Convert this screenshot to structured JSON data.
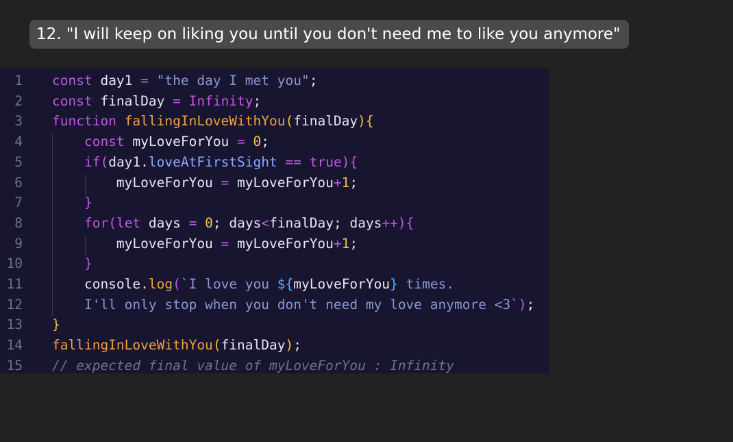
{
  "caption": "12.  \"I will keep on liking you until you don't need me to like you anymore\"",
  "code": {
    "lines": [
      {
        "num": "1",
        "tokens": [
          [
            "c-key",
            "const "
          ],
          [
            "c-var",
            "day1 "
          ],
          [
            "c-op",
            "= "
          ],
          [
            "c-str",
            "\"the day I met you\""
          ],
          [
            "c-punct",
            ";"
          ]
        ]
      },
      {
        "num": "2",
        "tokens": [
          [
            "c-key",
            "const "
          ],
          [
            "c-var",
            "finalDay "
          ],
          [
            "c-op",
            "= "
          ],
          [
            "c-key",
            "Infinity"
          ],
          [
            "c-punct",
            ";"
          ]
        ]
      },
      {
        "num": "3",
        "tokens": [
          [
            "c-key",
            "function "
          ],
          [
            "c-fn",
            "fallingInLoveWithYou"
          ],
          [
            "c-paren",
            "("
          ],
          [
            "c-var",
            "finalDay"
          ],
          [
            "c-paren",
            ")"
          ],
          [
            "c-paren",
            "{"
          ]
        ]
      },
      {
        "num": "4",
        "tokens": [
          [
            "c-var",
            "    "
          ],
          [
            "c-key",
            "const "
          ],
          [
            "c-var",
            "myLoveForYou "
          ],
          [
            "c-op",
            "= "
          ],
          [
            "c-num",
            "0"
          ],
          [
            "c-punct",
            ";"
          ]
        ]
      },
      {
        "num": "5",
        "tokens": [
          [
            "c-var",
            "    "
          ],
          [
            "c-key",
            "if"
          ],
          [
            "c-paren2",
            "("
          ],
          [
            "c-var",
            "day1."
          ],
          [
            "c-prop",
            "loveAtFirstSight "
          ],
          [
            "c-op",
            "== "
          ],
          [
            "c-key",
            "true"
          ],
          [
            "c-paren2",
            ")"
          ],
          [
            "c-paren2",
            "{"
          ]
        ]
      },
      {
        "num": "6",
        "tokens": [
          [
            "c-var",
            "        myLoveForYou "
          ],
          [
            "c-op",
            "= "
          ],
          [
            "c-var",
            "myLoveForYou"
          ],
          [
            "c-op",
            "+"
          ],
          [
            "c-num",
            "1"
          ],
          [
            "c-punct",
            ";"
          ]
        ]
      },
      {
        "num": "7",
        "tokens": [
          [
            "c-var",
            "    "
          ],
          [
            "c-paren2",
            "}"
          ]
        ]
      },
      {
        "num": "8",
        "tokens": [
          [
            "c-var",
            "    "
          ],
          [
            "c-key",
            "for"
          ],
          [
            "c-paren2",
            "("
          ],
          [
            "c-key",
            "let "
          ],
          [
            "c-var",
            "days "
          ],
          [
            "c-op",
            "= "
          ],
          [
            "c-num",
            "0"
          ],
          [
            "c-punct",
            "; "
          ],
          [
            "c-var",
            "days"
          ],
          [
            "c-op",
            "<"
          ],
          [
            "c-var",
            "finalDay"
          ],
          [
            "c-punct",
            "; "
          ],
          [
            "c-var",
            "days"
          ],
          [
            "c-op",
            "++"
          ],
          [
            "c-paren2",
            ")"
          ],
          [
            "c-paren2",
            "{"
          ]
        ]
      },
      {
        "num": "9",
        "tokens": [
          [
            "c-var",
            "        myLoveForYou "
          ],
          [
            "c-op",
            "= "
          ],
          [
            "c-var",
            "myLoveForYou"
          ],
          [
            "c-op",
            "+"
          ],
          [
            "c-num",
            "1"
          ],
          [
            "c-punct",
            ";"
          ]
        ]
      },
      {
        "num": "10",
        "tokens": [
          [
            "c-var",
            "    "
          ],
          [
            "c-paren2",
            "}"
          ]
        ]
      },
      {
        "num": "11",
        "tokens": [
          [
            "c-var",
            "    console."
          ],
          [
            "c-fn",
            "log"
          ],
          [
            "c-paren2",
            "("
          ],
          [
            "c-str",
            "`I love you "
          ],
          [
            "c-paren3",
            "${"
          ],
          [
            "c-var",
            "myLoveForYou"
          ],
          [
            "c-paren3",
            "}"
          ],
          [
            "c-str",
            " times."
          ]
        ]
      },
      {
        "num": "12",
        "tokens": [
          [
            "c-str",
            "    I'll only stop when you don't need my love anymore <3`"
          ],
          [
            "c-paren2",
            ")"
          ],
          [
            "c-punct",
            ";"
          ]
        ]
      },
      {
        "num": "13",
        "tokens": [
          [
            "c-paren",
            "}"
          ]
        ]
      },
      {
        "num": "14",
        "tokens": [
          [
            "c-fn",
            "fallingInLoveWithYou"
          ],
          [
            "c-paren",
            "("
          ],
          [
            "c-var",
            "finalDay"
          ],
          [
            "c-paren",
            ")"
          ],
          [
            "c-punct",
            ";"
          ]
        ]
      },
      {
        "num": "15",
        "tokens": [
          [
            "c-comment",
            "// expected final value of myLoveForYou : Infinity"
          ]
        ]
      }
    ]
  }
}
